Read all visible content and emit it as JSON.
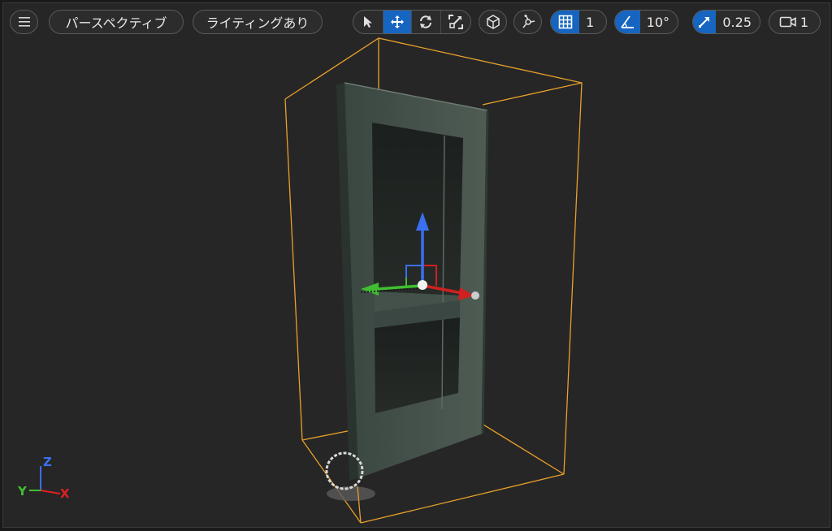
{
  "toolbar": {
    "menu_icon": "hamburger-menu-icon",
    "view_mode_label": "パースペクティブ",
    "lighting_mode_label": "ライティングあり",
    "tools": [
      {
        "name": "select-tool",
        "icon": "cursor-arrow-icon",
        "active": false
      },
      {
        "name": "translate-tool",
        "icon": "move-arrows-icon",
        "active": true
      },
      {
        "name": "rotate-tool",
        "icon": "rotate-icon",
        "active": false
      },
      {
        "name": "scale-tool",
        "icon": "scale-icon",
        "active": false
      }
    ],
    "world_local_icon": "world-space-icon",
    "surface_snap_icon": "surface-snap-icon",
    "grid_snap_value": "1",
    "rotation_snap_value": "10°",
    "scale_snap_value": "0.25",
    "camera_speed_value": "1"
  },
  "axis_indicator": {
    "x_label": "X",
    "y_label": "Y",
    "z_label": "Z",
    "x_color": "#e02020",
    "y_color": "#3fbf2f",
    "z_color": "#3a6ff0"
  },
  "colors": {
    "active_toggle": "#1665c0",
    "selection_bounds": "#e8a02a",
    "viewport_background": "#262626"
  }
}
